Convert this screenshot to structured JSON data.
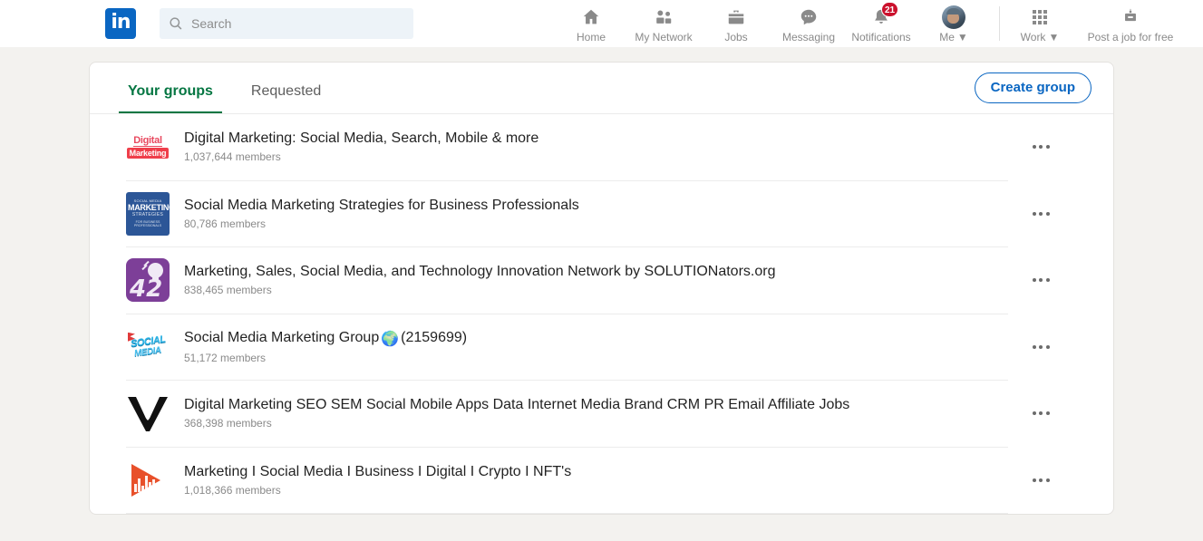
{
  "header": {
    "logo_text": "in",
    "logo_color": "#0a66c2",
    "search": {
      "placeholder": "Search",
      "value": "",
      "icon": "search-icon"
    },
    "nav": [
      {
        "label": "Home",
        "icon": "home-icon"
      },
      {
        "label": "My Network",
        "icon": "people-icon"
      },
      {
        "label": "Jobs",
        "icon": "briefcase-icon"
      },
      {
        "label": "Messaging",
        "icon": "message-bubble-icon"
      },
      {
        "label": "Notifications",
        "icon": "bell-icon",
        "badge": "21",
        "badge_color": "#cb112d"
      },
      {
        "label": "Me",
        "icon": "avatar-icon",
        "caret": "▼"
      }
    ],
    "right": [
      {
        "label": "Work",
        "icon": "grid-apps-icon",
        "caret": "▼"
      },
      {
        "label": "Post a job for free",
        "icon": "post-job-icon"
      }
    ]
  },
  "card": {
    "tabs": [
      {
        "label": "Your groups",
        "active": true
      },
      {
        "label": "Requested",
        "active": false
      }
    ],
    "active_tab_color": "#057642",
    "create_button": {
      "label": "Create group",
      "color": "#0a66c2"
    },
    "groups": [
      {
        "title": "Digital Marketing: Social Media, Search, Mobile & more",
        "members": "1,037,644 members",
        "logo": "digital-marketing-logo",
        "logo_text_1": "Digital",
        "logo_text_2": "Marketing",
        "logo_color": "#ef3e4a",
        "menu": "overflow-menu-icon"
      },
      {
        "title": "Social Media Marketing Strategies for Business Professionals",
        "members": "80,786 members",
        "logo": "social-media-marketing-strategies-logo",
        "logo_text_1": "SOCIAL MEDIA",
        "logo_text_2": "MARKETING",
        "logo_text_3": "STRATEGIES",
        "logo_text_4": "FOR BUSINESS",
        "logo_text_5": "PROFESSIONALS",
        "logo_color": "#2c5697",
        "menu": "overflow-menu-icon"
      },
      {
        "title": "Marketing, Sales, Social Media, and Technology Innovation Network by SOLUTIONators.org",
        "members": "838,465 members",
        "logo": "solutionators-logo",
        "logo_text_1": "42",
        "logo_color": "#7d3f98",
        "menu": "overflow-menu-icon"
      },
      {
        "title_before": "Social Media Marketing Group",
        "title_globe": "🌍",
        "title_after": "(2159699)",
        "title": "Social Media Marketing Group 🌍 (2159699)",
        "members": "51,172 members",
        "logo": "social-media-group-logo",
        "logo_text_1": "SOCIAL",
        "logo_text_2": "MEDIA",
        "logo_color": "#2eb6e8",
        "menu": "overflow-menu-icon"
      },
      {
        "title": "Digital Marketing SEO SEM Social Mobile Apps Data Internet Media Brand CRM PR Email Affiliate Jobs",
        "members": "368,398 members",
        "logo": "seo-sem-w-logo",
        "logo_color": "#111111",
        "menu": "overflow-menu-icon"
      },
      {
        "title": "Marketing I Social Media I Business I Digital I Crypto I NFT's",
        "members": "1,018,366 members",
        "logo": "marketing-nft-play-logo",
        "logo_color": "#e8502a",
        "menu": "overflow-menu-icon"
      }
    ]
  }
}
